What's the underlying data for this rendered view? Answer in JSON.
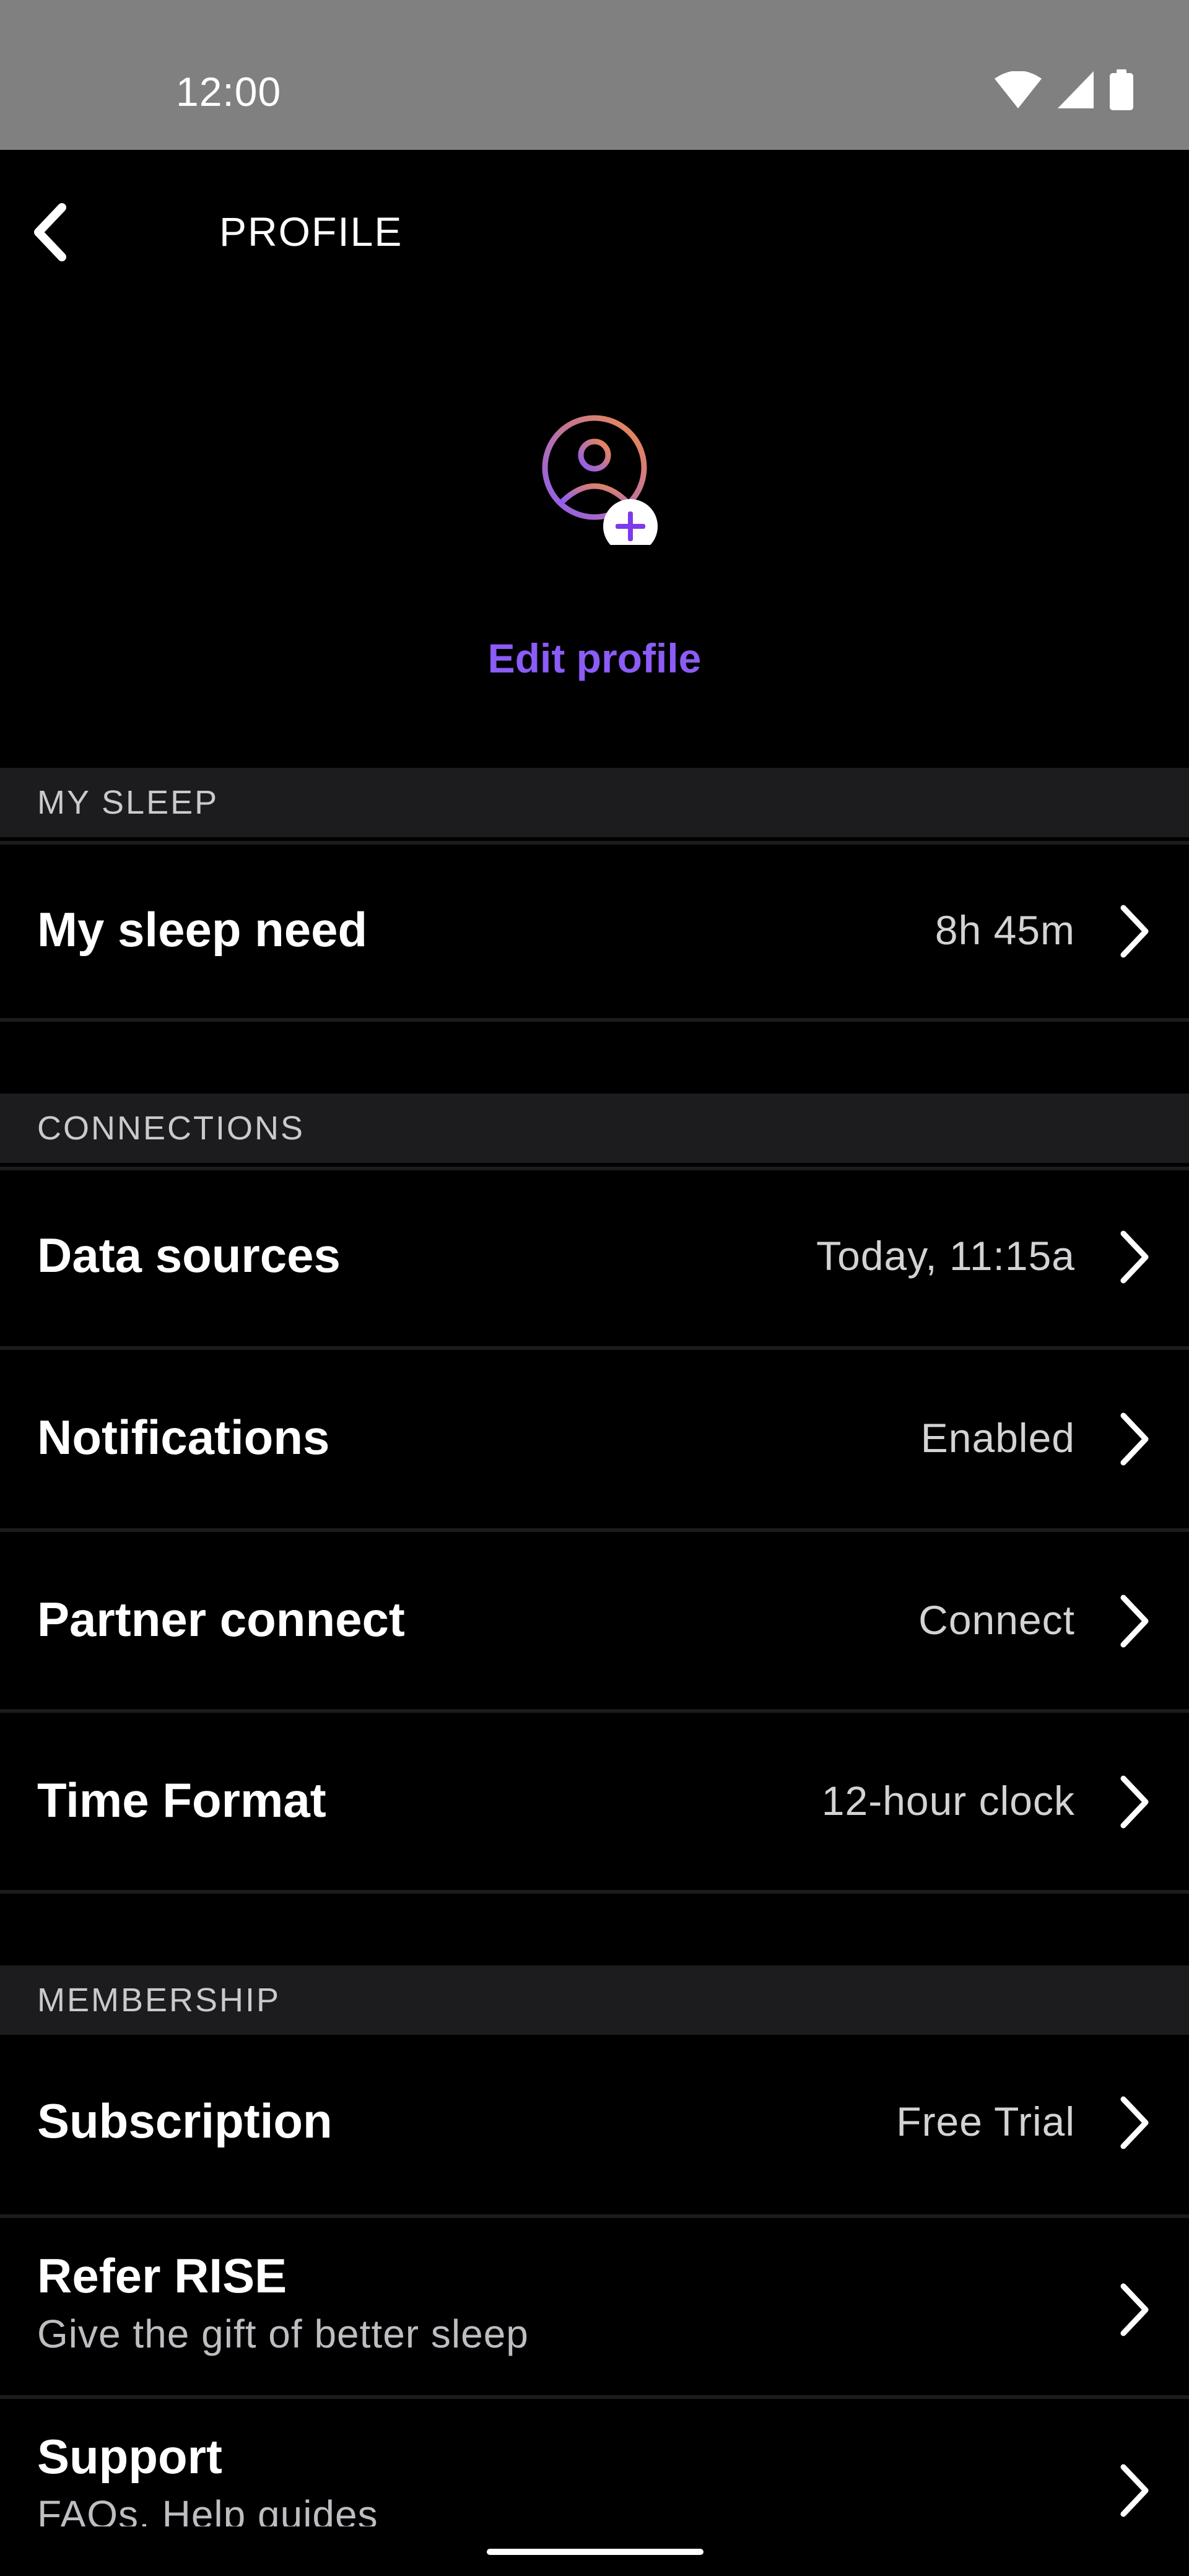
{
  "status_bar": {
    "time": "12:00",
    "icons": [
      "wifi-icon",
      "cellular-signal-icon",
      "battery-icon"
    ]
  },
  "header": {
    "title": "PROFILE",
    "back_icon": "chevron-left-icon"
  },
  "profile": {
    "avatar_icon": "user-add-icon",
    "edit_label": "Edit profile"
  },
  "colors": {
    "accent": "#8b5cf6",
    "background": "#000000",
    "section_bg": "#1c1c1e",
    "status_bar": "#808080"
  },
  "sections": {
    "my_sleep": {
      "title": "MY SLEEP",
      "rows": [
        {
          "label": "My sleep need",
          "value": "8h 45m"
        }
      ]
    },
    "connections": {
      "title": "CONNECTIONS",
      "rows": [
        {
          "label": "Data sources",
          "value": "Today, 11:15a"
        },
        {
          "label": "Notifications",
          "value": "Enabled"
        },
        {
          "label": "Partner connect",
          "value": "Connect"
        },
        {
          "label": "Time Format",
          "value": "12-hour clock"
        }
      ]
    },
    "membership": {
      "title": "MEMBERSHIP",
      "rows": [
        {
          "label": "Subscription",
          "value": "Free Trial"
        },
        {
          "label": "Refer RISE",
          "subtitle": "Give the gift of better sleep"
        },
        {
          "label": "Support",
          "subtitle": "FAQs, Help guides"
        }
      ]
    }
  }
}
